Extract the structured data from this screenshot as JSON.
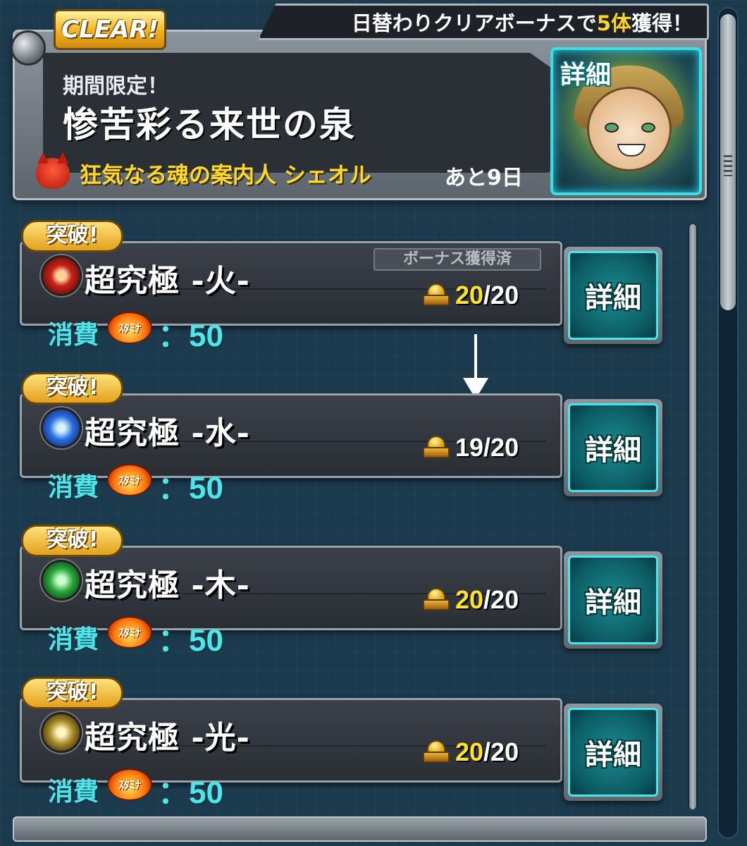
{
  "event": {
    "clear_badge": "CLEAR!",
    "notice_prefix": "日替わりクリアボーナスで",
    "notice_highlight": "5体",
    "notice_suffix": "獲得！",
    "limited_label": "期間限定！",
    "title": "惨苦彩る来世の泉",
    "guide": "狂気なる魂の案内人 シェオル",
    "remaining": "あと9日",
    "portrait_label": "詳細"
  },
  "quests": [
    {
      "badge": "突破!",
      "name": "超究極 -火-",
      "element": "fire",
      "bonus_tag": "ボーナス獲得済",
      "count_got": "20",
      "count_total": "/20",
      "cost_label": "消費",
      "stamina_label": "ｽﾀﾐﾅ",
      "cost_value": "：50",
      "detail": "詳細"
    },
    {
      "badge": "突破!",
      "name": "超究極 -水-",
      "element": "water",
      "bonus_tag": "",
      "count_got": "19",
      "count_total": "/20",
      "cost_label": "消費",
      "stamina_label": "ｽﾀﾐﾅ",
      "cost_value": "：50",
      "detail": "詳細"
    },
    {
      "badge": "突破!",
      "name": "超究極 -木-",
      "element": "wood",
      "bonus_tag": "",
      "count_got": "20",
      "count_total": "/20",
      "cost_label": "消費",
      "stamina_label": "ｽﾀﾐﾅ",
      "cost_value": "：50",
      "detail": "詳細"
    },
    {
      "badge": "突破!",
      "name": "超究極 -光-",
      "element": "light",
      "bonus_tag": "",
      "count_got": "20",
      "count_total": "/20",
      "cost_label": "消費",
      "stamina_label": "ｽﾀﾐﾅ",
      "cost_value": "：50",
      "detail": "詳細"
    }
  ],
  "colors": {
    "accent_cyan": "#4fe3ea",
    "gold": "#ffe229",
    "background": "#1c3a4d"
  }
}
